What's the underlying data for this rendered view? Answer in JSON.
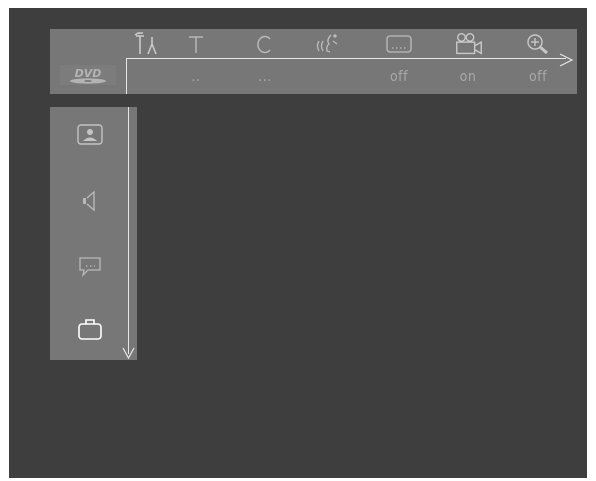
{
  "top_menu": {
    "disc_logo": "DVD",
    "items": [
      {
        "icon": "preferences-icon",
        "value": ""
      },
      {
        "icon": "title-icon",
        "value": ".."
      },
      {
        "icon": "chapter-icon",
        "value": "..."
      },
      {
        "icon": "audio-language-icon",
        "value": ""
      },
      {
        "icon": "subtitle-icon",
        "value": "off"
      },
      {
        "icon": "camera-angle-icon",
        "value": "on"
      },
      {
        "icon": "zoom-icon",
        "value": "off"
      }
    ]
  },
  "side_menu": {
    "items": [
      {
        "icon": "picture-settings-icon",
        "active": false
      },
      {
        "icon": "sound-settings-icon",
        "active": false
      },
      {
        "icon": "language-settings-icon",
        "active": false
      },
      {
        "icon": "features-settings-icon",
        "active": true
      }
    ]
  },
  "colors": {
    "background": "#3e3e3e",
    "menu_bar": "#777777",
    "icon_dim": "#bcbcbc",
    "icon_active": "#ffffff"
  }
}
